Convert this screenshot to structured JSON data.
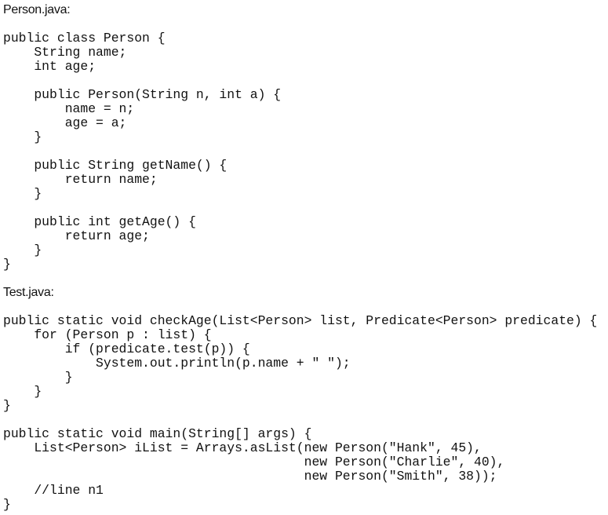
{
  "files": [
    {
      "title": "Person.java:",
      "lines": [
        "public class Person {",
        "    String name;",
        "    int age;",
        "",
        "    public Person(String n, int a) {",
        "        name = n;",
        "        age = a;",
        "    }",
        "",
        "    public String getName() {",
        "        return name;",
        "    }",
        "",
        "    public int getAge() {",
        "        return age;",
        "    }",
        "}"
      ]
    },
    {
      "title": "Test.java:",
      "lines": [
        "public static void checkAge(List<Person> list, Predicate<Person> predicate) {",
        "    for (Person p : list) {",
        "        if (predicate.test(p)) {",
        "            System.out.println(p.name + \" \");",
        "        }",
        "    }",
        "}",
        "",
        "public static void main(String[] args) {",
        "    List<Person> iList = Arrays.asList(new Person(\"Hank\", 45),",
        "                                       new Person(\"Charlie\", 40),",
        "                                       new Person(\"Smith\", 38));",
        "    //line n1",
        "}"
      ]
    }
  ]
}
